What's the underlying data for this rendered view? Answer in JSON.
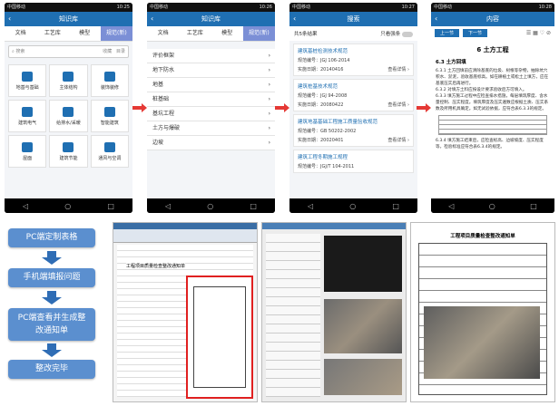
{
  "colors": {
    "accent": "#1f6fb2",
    "tab_active": "#7b8fd6",
    "arrow": "#e53935",
    "flow_box": "#5b8fcf",
    "flow_arrow": "#2f6db5",
    "highlight": "#e02020"
  },
  "phone1": {
    "title": "知识库",
    "tabs": [
      "文档",
      "工艺库",
      "模型",
      "规范(新)"
    ],
    "search_placeholder": "搜索",
    "search_links": [
      "收藏",
      "目录"
    ],
    "tiles": [
      "地基与基础",
      "主体结构",
      "装饰装修",
      "建筑电气",
      "给排水/采暖",
      "智能建筑",
      "屋面",
      "建筑节能",
      "通风与空调"
    ]
  },
  "phone2": {
    "title": "知识库",
    "tabs": [
      "文档",
      "工艺库",
      "模型",
      "规范(新)"
    ],
    "items": [
      "评价框架",
      "地下防水",
      "地基",
      "桩基础",
      "基坑工程",
      "土方与爆破",
      "边坡"
    ]
  },
  "phone3": {
    "title": "搜索",
    "header": "共5条结果",
    "toggle_label": "只看强条",
    "cards": [
      {
        "title": "建筑基桩检测技术规范",
        "code": "规范编号：JGJ 106-2014",
        "date": "实施日期：20140416",
        "link": "查看详情 ›"
      },
      {
        "title": "建筑桩基技术规范",
        "code": "规范编号：JGJ 94-2008",
        "date": "实施日期：20080422",
        "link": "查看详情 ›"
      },
      {
        "title": "建筑地基基础工程施工质量验收规范",
        "code": "规范编号：GB 50202-2002",
        "date": "实施日期：20020401",
        "link": "查看详情 ›"
      },
      {
        "title": "建筑工程冬期施工规程",
        "code": "规范编号：JGJ/T 104-2011",
        "date": "",
        "link": ""
      }
    ]
  },
  "phone4": {
    "title": "内容",
    "nav": [
      "上一节",
      "下一节"
    ],
    "heading": "6 土方工程",
    "subheading": "6.3 土方回填",
    "paras": [
      "6.3.1 土方回填前应清除基底的垃圾、树根等杂物，抽除坑穴积水、淤泥，验收基底标高。如在耕植土或松土上填方，应在基底压实后再进行。",
      "6.3.2 对填方土料应按设计要求验收后方可填入。",
      "6.3.3 填方施工过程中应检查排水措施，每层填筑厚度、含水量控制、压实程度。填筑厚度及压实遍数应根据土质、压实系数及所用机具确定。如无试验依据，应符合表6.3.3的规定。",
      "6.3.4 填方施工结束后，应检查标高、边坡坡度、压实程度等，检验标准应符合表6.3.4的规定。"
    ]
  },
  "flow": [
    "PC端定制表格",
    "手机端填报问题",
    "PC端查看并生成整改通知单",
    "整改完毕"
  ],
  "shot1": {
    "form_title": "工程项目质量检查整改通知单"
  },
  "shot4": {
    "title": "工程项目质量检查整改通知单"
  }
}
